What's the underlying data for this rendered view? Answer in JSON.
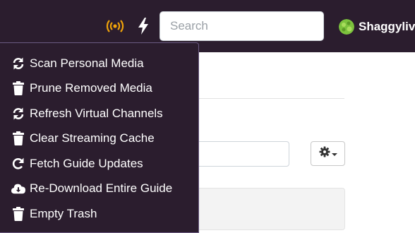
{
  "colors": {
    "nav_bg": "#2b1d2e",
    "accent": "#f0a30a",
    "menu_border": "#6a5a82"
  },
  "header": {
    "broadcast_icon": "broadcast-icon",
    "bolt_icon": "bolt-icon",
    "search": {
      "placeholder": "Search",
      "value": ""
    },
    "user": {
      "name": "Shaggylive",
      "avatar_icon": "avatar"
    }
  },
  "menu": {
    "items": [
      {
        "label": "Scan Personal Media",
        "icon": "sync-icon"
      },
      {
        "label": "Prune Removed Media",
        "icon": "trash-icon"
      },
      {
        "label": "Refresh Virtual Channels",
        "icon": "sync-icon"
      },
      {
        "label": "Clear Streaming Cache",
        "icon": "trash-icon"
      },
      {
        "label": "Fetch Guide Updates",
        "icon": "redo-icon"
      },
      {
        "label": "Re-Download Entire Guide",
        "icon": "cloud-download-icon"
      },
      {
        "label": "Empty Trash",
        "icon": "trash-icon"
      }
    ]
  },
  "content": {
    "settings_button_icon": "gear-icon"
  }
}
